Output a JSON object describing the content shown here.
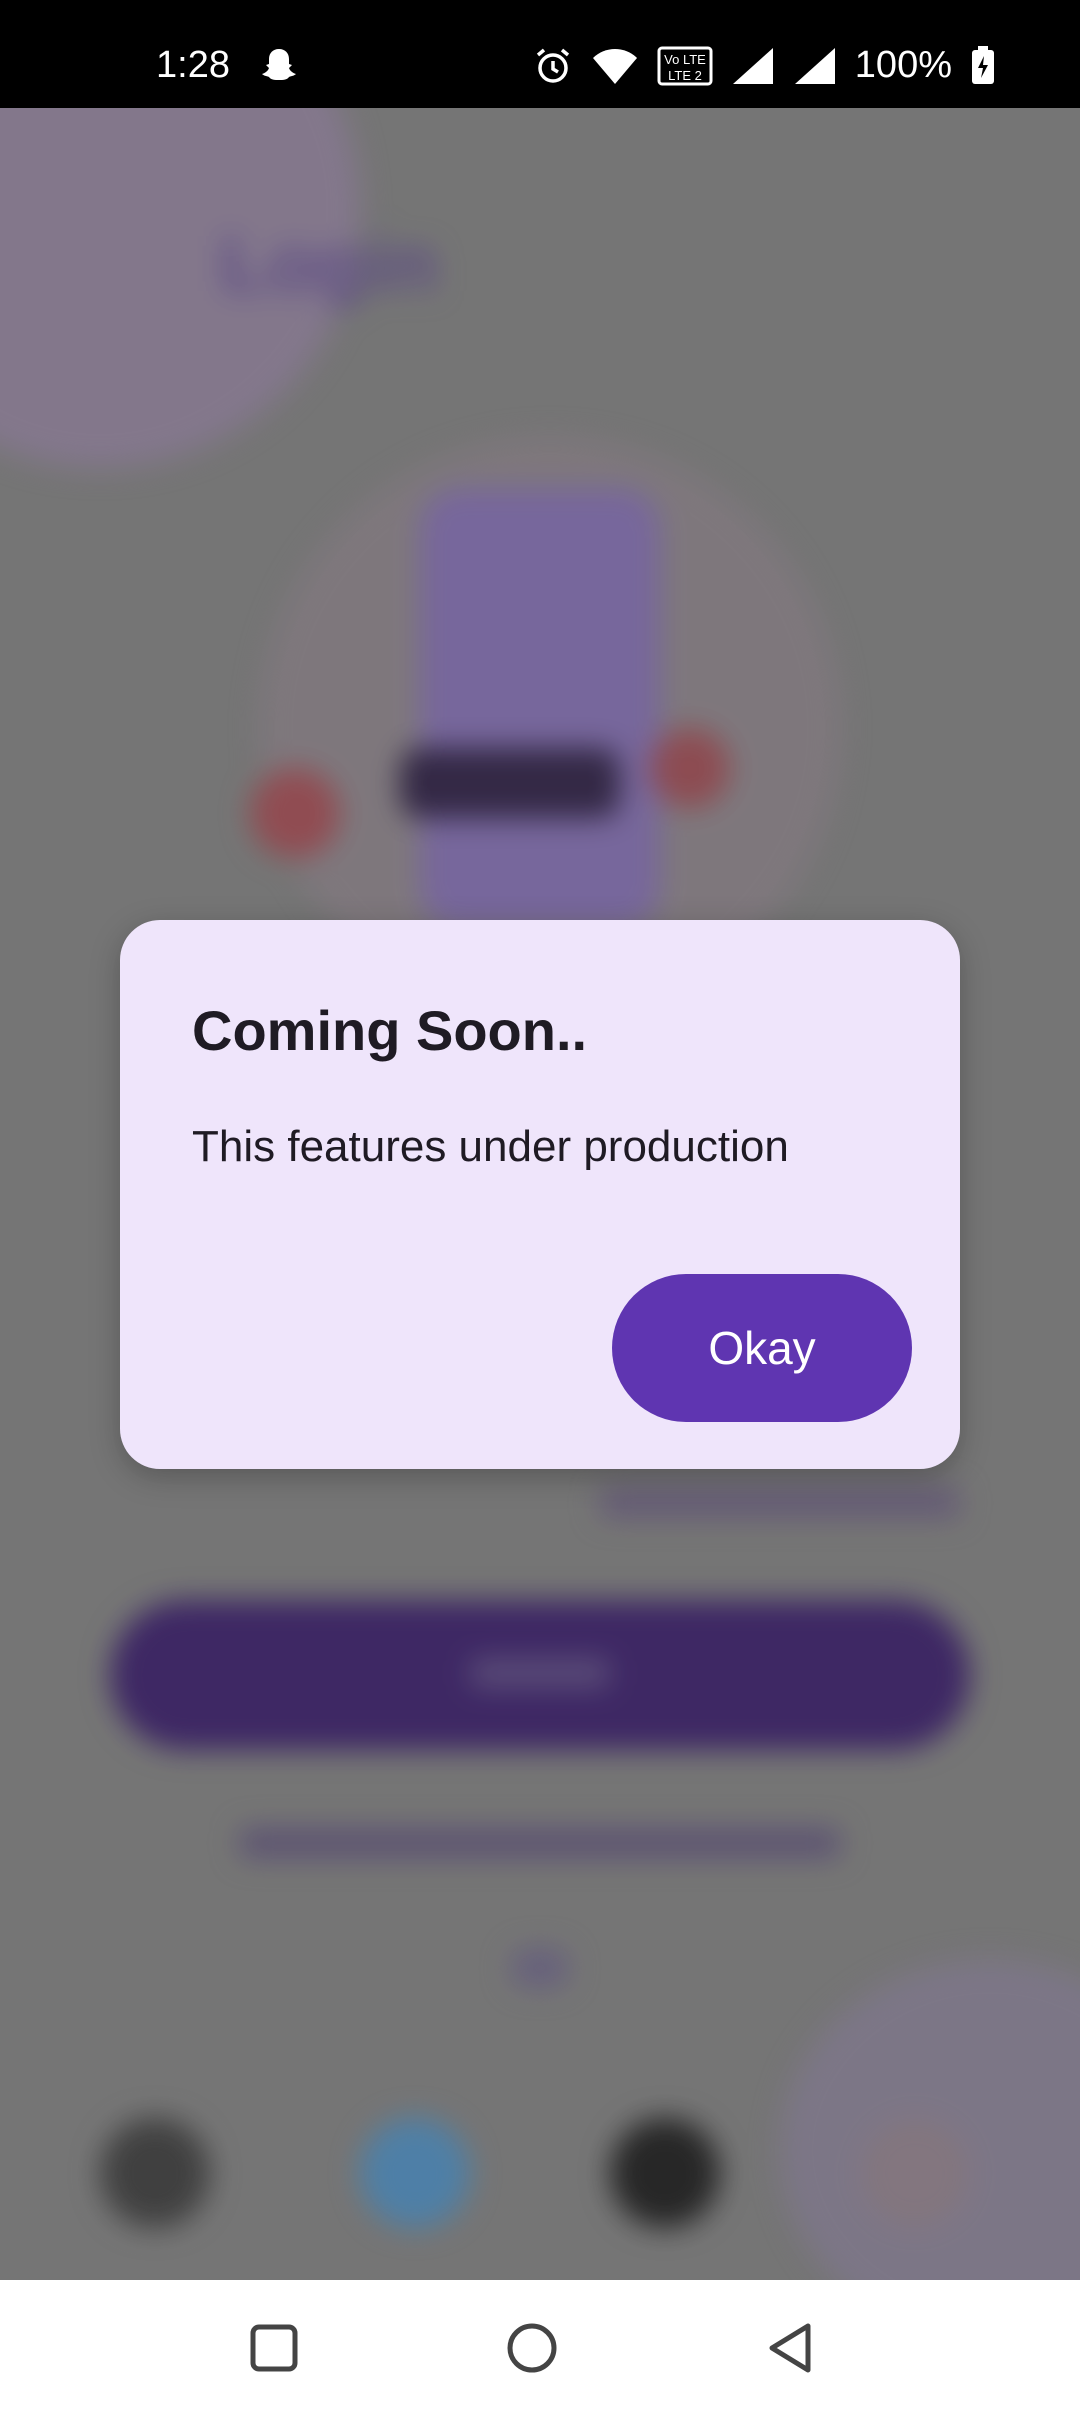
{
  "status_bar": {
    "time": "1:28",
    "battery": "100%",
    "icons": [
      "snapchat-icon",
      "alarm-icon",
      "wifi-icon",
      "volte-icon",
      "signal-icon",
      "signal-icon",
      "battery-charging-icon"
    ]
  },
  "background": {
    "title": "Login"
  },
  "dialog": {
    "title": "Coming Soon..",
    "message": "This features under production",
    "okay_label": "Okay"
  },
  "colors": {
    "dialog_bg": "#efe5fb",
    "primary": "#5f35b1"
  },
  "nav_bar": {
    "buttons": [
      "recent-apps-icon",
      "home-icon",
      "back-icon"
    ]
  }
}
